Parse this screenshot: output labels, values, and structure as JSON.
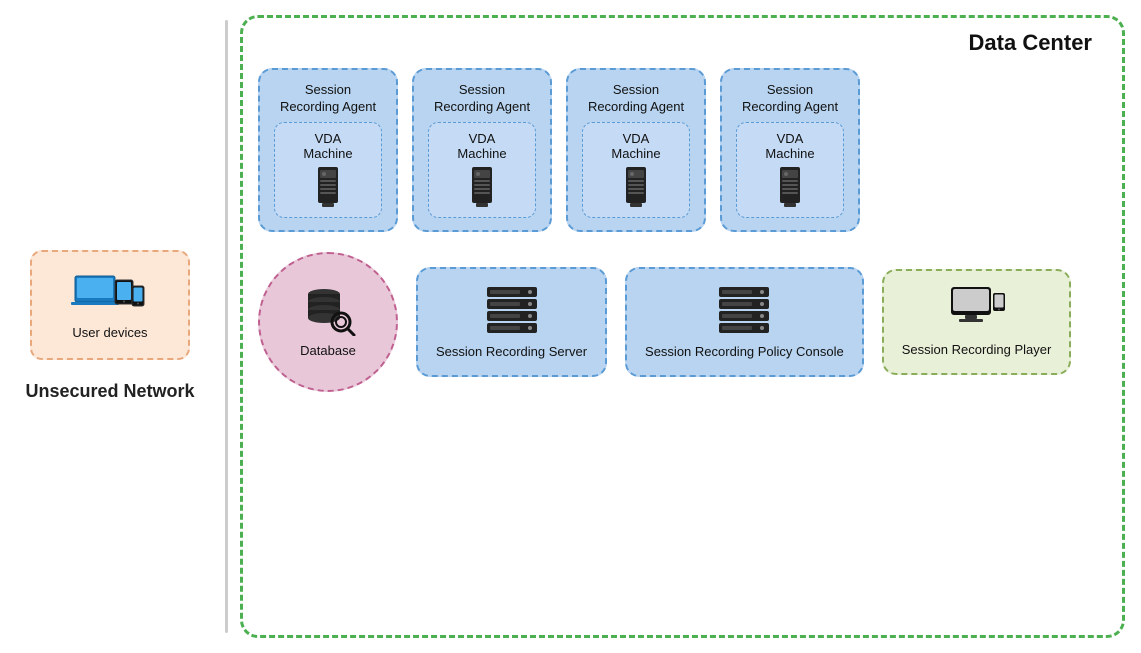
{
  "unsecured_network": {
    "label": "Unsecured Network",
    "user_devices_label": "User devices"
  },
  "data_center": {
    "title": "Data Center",
    "agents": [
      {
        "id": 1,
        "line1": "Session",
        "line2": "Recording Agent",
        "vda_line1": "VDA",
        "vda_line2": "Machine"
      },
      {
        "id": 2,
        "line1": "Session",
        "line2": "Recording Agent",
        "vda_line1": "VDA",
        "vda_line2": "Machine"
      },
      {
        "id": 3,
        "line1": "Session",
        "line2": "Recording Agent",
        "vda_line1": "VDA",
        "vda_line2": "Machine"
      },
      {
        "id": 4,
        "line1": "Session",
        "line2": "Recording Agent",
        "vda_line1": "VDA",
        "vda_line2": "Machine"
      }
    ],
    "database_label": "Database",
    "session_recording_server_label": "Session Recording Server",
    "session_recording_policy_console_label": "Session Recording Policy Console",
    "session_recording_player_label": "Session Recording Player"
  },
  "icons": {
    "user_devices": "🖥️",
    "computer_tower": "🖥️",
    "database": "🗄️",
    "server": "🖥️",
    "player": "💻"
  }
}
